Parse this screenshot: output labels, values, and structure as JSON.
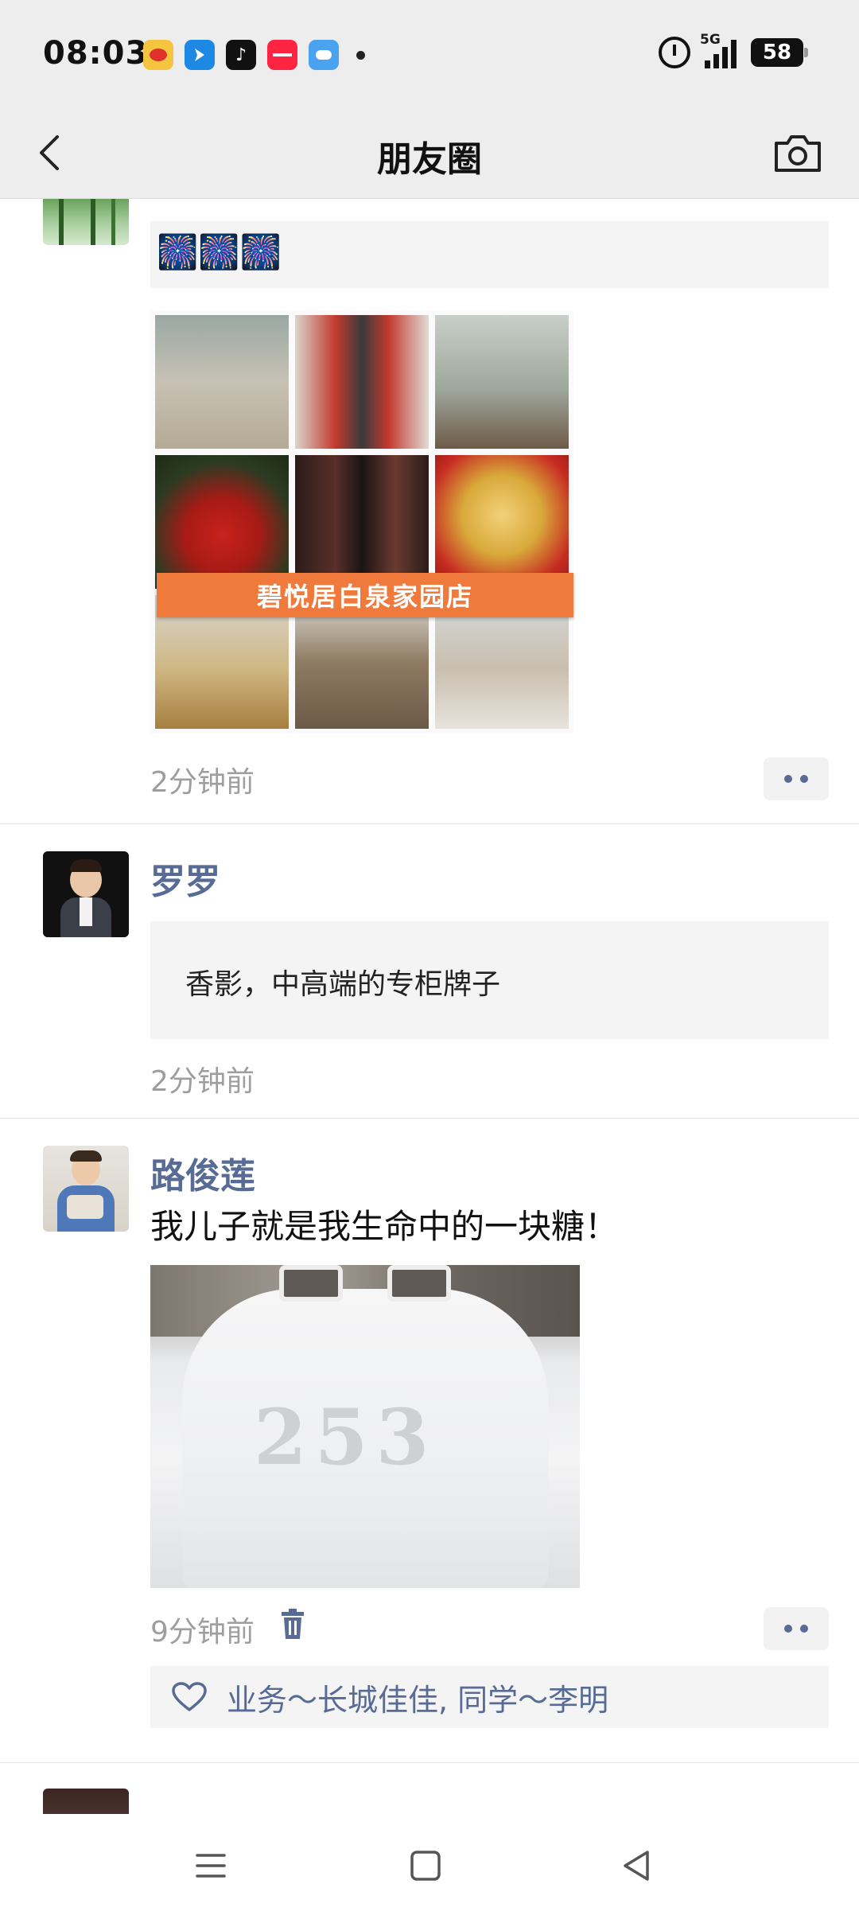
{
  "status_bar": {
    "time": "08:03",
    "network": "5G",
    "battery": "58",
    "apps": [
      {
        "name": "weibo-app-icon",
        "color": "#f5c542",
        "glyph": ""
      },
      {
        "name": "blue-arrow-app-icon",
        "color": "#1e88e5",
        "glyph": ""
      },
      {
        "name": "douyin-app-icon",
        "color": "#111111",
        "glyph": "♪"
      },
      {
        "name": "xiaohongshu-app-icon",
        "color": "#ff2442",
        "glyph": ""
      },
      {
        "name": "weather-app-icon",
        "color": "#4aa3f0",
        "glyph": ""
      }
    ]
  },
  "header": {
    "title": "朋友圈"
  },
  "posts": [
    {
      "author": "",
      "text": "🎆🎆🎆",
      "banner": "碧悦居白泉家园店",
      "time": "2分钟前"
    },
    {
      "author": "罗罗",
      "text": "香影，中高端的专柜牌子",
      "time": "2分钟前"
    },
    {
      "author": "路俊莲",
      "text": "我儿子就是我生命中的一块糖！",
      "time": "9分钟前",
      "likes": "业务～长城佳佳, 同学～李明"
    }
  ],
  "colors": {
    "link": "#576b95",
    "header_bg": "#ededed",
    "card_bg": "#f4f4f4",
    "banner": "#f07a3b"
  }
}
